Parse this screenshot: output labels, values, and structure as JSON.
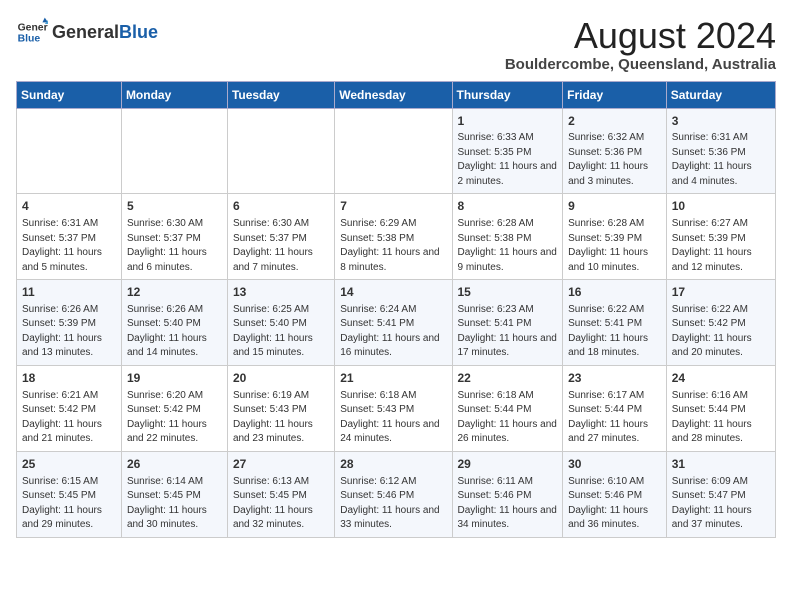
{
  "logo": {
    "text_general": "General",
    "text_blue": "Blue"
  },
  "title": "August 2024",
  "subtitle": "Bouldercombe, Queensland, Australia",
  "days_of_week": [
    "Sunday",
    "Monday",
    "Tuesday",
    "Wednesday",
    "Thursday",
    "Friday",
    "Saturday"
  ],
  "weeks": [
    [
      {
        "day": "",
        "content": ""
      },
      {
        "day": "",
        "content": ""
      },
      {
        "day": "",
        "content": ""
      },
      {
        "day": "",
        "content": ""
      },
      {
        "day": "1",
        "content": "Sunrise: 6:33 AM\nSunset: 5:35 PM\nDaylight: 11 hours and 2 minutes."
      },
      {
        "day": "2",
        "content": "Sunrise: 6:32 AM\nSunset: 5:36 PM\nDaylight: 11 hours and 3 minutes."
      },
      {
        "day": "3",
        "content": "Sunrise: 6:31 AM\nSunset: 5:36 PM\nDaylight: 11 hours and 4 minutes."
      }
    ],
    [
      {
        "day": "4",
        "content": "Sunrise: 6:31 AM\nSunset: 5:37 PM\nDaylight: 11 hours and 5 minutes."
      },
      {
        "day": "5",
        "content": "Sunrise: 6:30 AM\nSunset: 5:37 PM\nDaylight: 11 hours and 6 minutes."
      },
      {
        "day": "6",
        "content": "Sunrise: 6:30 AM\nSunset: 5:37 PM\nDaylight: 11 hours and 7 minutes."
      },
      {
        "day": "7",
        "content": "Sunrise: 6:29 AM\nSunset: 5:38 PM\nDaylight: 11 hours and 8 minutes."
      },
      {
        "day": "8",
        "content": "Sunrise: 6:28 AM\nSunset: 5:38 PM\nDaylight: 11 hours and 9 minutes."
      },
      {
        "day": "9",
        "content": "Sunrise: 6:28 AM\nSunset: 5:39 PM\nDaylight: 11 hours and 10 minutes."
      },
      {
        "day": "10",
        "content": "Sunrise: 6:27 AM\nSunset: 5:39 PM\nDaylight: 11 hours and 12 minutes."
      }
    ],
    [
      {
        "day": "11",
        "content": "Sunrise: 6:26 AM\nSunset: 5:39 PM\nDaylight: 11 hours and 13 minutes."
      },
      {
        "day": "12",
        "content": "Sunrise: 6:26 AM\nSunset: 5:40 PM\nDaylight: 11 hours and 14 minutes."
      },
      {
        "day": "13",
        "content": "Sunrise: 6:25 AM\nSunset: 5:40 PM\nDaylight: 11 hours and 15 minutes."
      },
      {
        "day": "14",
        "content": "Sunrise: 6:24 AM\nSunset: 5:41 PM\nDaylight: 11 hours and 16 minutes."
      },
      {
        "day": "15",
        "content": "Sunrise: 6:23 AM\nSunset: 5:41 PM\nDaylight: 11 hours and 17 minutes."
      },
      {
        "day": "16",
        "content": "Sunrise: 6:22 AM\nSunset: 5:41 PM\nDaylight: 11 hours and 18 minutes."
      },
      {
        "day": "17",
        "content": "Sunrise: 6:22 AM\nSunset: 5:42 PM\nDaylight: 11 hours and 20 minutes."
      }
    ],
    [
      {
        "day": "18",
        "content": "Sunrise: 6:21 AM\nSunset: 5:42 PM\nDaylight: 11 hours and 21 minutes."
      },
      {
        "day": "19",
        "content": "Sunrise: 6:20 AM\nSunset: 5:42 PM\nDaylight: 11 hours and 22 minutes."
      },
      {
        "day": "20",
        "content": "Sunrise: 6:19 AM\nSunset: 5:43 PM\nDaylight: 11 hours and 23 minutes."
      },
      {
        "day": "21",
        "content": "Sunrise: 6:18 AM\nSunset: 5:43 PM\nDaylight: 11 hours and 24 minutes."
      },
      {
        "day": "22",
        "content": "Sunrise: 6:18 AM\nSunset: 5:44 PM\nDaylight: 11 hours and 26 minutes."
      },
      {
        "day": "23",
        "content": "Sunrise: 6:17 AM\nSunset: 5:44 PM\nDaylight: 11 hours and 27 minutes."
      },
      {
        "day": "24",
        "content": "Sunrise: 6:16 AM\nSunset: 5:44 PM\nDaylight: 11 hours and 28 minutes."
      }
    ],
    [
      {
        "day": "25",
        "content": "Sunrise: 6:15 AM\nSunset: 5:45 PM\nDaylight: 11 hours and 29 minutes."
      },
      {
        "day": "26",
        "content": "Sunrise: 6:14 AM\nSunset: 5:45 PM\nDaylight: 11 hours and 30 minutes."
      },
      {
        "day": "27",
        "content": "Sunrise: 6:13 AM\nSunset: 5:45 PM\nDaylight: 11 hours and 32 minutes."
      },
      {
        "day": "28",
        "content": "Sunrise: 6:12 AM\nSunset: 5:46 PM\nDaylight: 11 hours and 33 minutes."
      },
      {
        "day": "29",
        "content": "Sunrise: 6:11 AM\nSunset: 5:46 PM\nDaylight: 11 hours and 34 minutes."
      },
      {
        "day": "30",
        "content": "Sunrise: 6:10 AM\nSunset: 5:46 PM\nDaylight: 11 hours and 36 minutes."
      },
      {
        "day": "31",
        "content": "Sunrise: 6:09 AM\nSunset: 5:47 PM\nDaylight: 11 hours and 37 minutes."
      }
    ]
  ]
}
